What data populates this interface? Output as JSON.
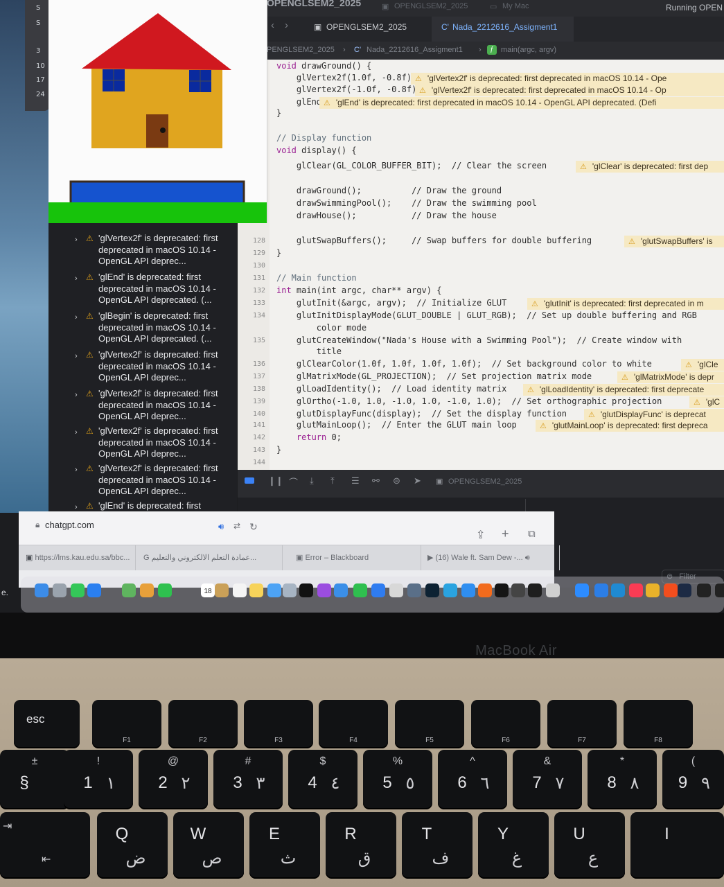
{
  "xcode": {
    "window_title": "OPENGLSEM2_2025",
    "tabs": [
      {
        "label": "OPENGLSEM2_2025"
      },
      {
        "label": "Nada_2212616_Assigment1"
      }
    ],
    "run_status": "Running OPEN",
    "titlebar_project": "OPENGLSEM2_2025",
    "titlebar_device": "My Mac",
    "jumpbar": [
      "PENGLSEM2_2025",
      "Nada_2212616_Assigment1",
      "main(argc, argv)"
    ],
    "code_lines": [
      {
        "num": "",
        "text": "void drawGround() {",
        "warning": ""
      },
      {
        "num": "",
        "text": "    glVertex2f(1.0f, -0.8f);",
        "warning": "'glVertex2f' is deprecated: first deprecated in macOS 10.14 - Ope"
      },
      {
        "num": "",
        "text": "    glVertex2f(-1.0f, -0.8f);",
        "warning": "'glVertex2f' is deprecated: first deprecated in macOS 10.14 - Op"
      },
      {
        "num": "",
        "text": "    glEnd();",
        "warning": "'glEnd' is deprecated: first deprecated in macOS 10.14 - OpenGL API deprecated. (Defi"
      },
      {
        "num": "",
        "text": "}",
        "warning": ""
      },
      {
        "num": "",
        "text": "",
        "warning": ""
      },
      {
        "num": "",
        "text": "// Display function",
        "warning": ""
      },
      {
        "num": "",
        "text": "void display() {",
        "warning": ""
      },
      {
        "num": "",
        "text": "    glClear(GL_COLOR_BUFFER_BIT);  // Clear the screen",
        "warning": "'glClear' is deprecated: first dep"
      },
      {
        "num": "",
        "text": "",
        "warning": ""
      },
      {
        "num": "",
        "text": "    drawGround();          // Draw the ground",
        "warning": ""
      },
      {
        "num": "",
        "text": "    drawSwimmingPool();    // Draw the swimming pool",
        "warning": ""
      },
      {
        "num": "",
        "text": "    drawHouse();           // Draw the house",
        "warning": ""
      },
      {
        "num": "",
        "text": "",
        "warning": ""
      },
      {
        "num": "128",
        "text": "    glutSwapBuffers();     // Swap buffers for double buffering",
        "warning": "'glutSwapBuffers' is"
      },
      {
        "num": "129",
        "text": "}",
        "warning": ""
      },
      {
        "num": "130",
        "text": "",
        "warning": ""
      },
      {
        "num": "131",
        "text": "// Main function",
        "warning": ""
      },
      {
        "num": "132",
        "text": "int main(int argc, char** argv) {",
        "warning": ""
      },
      {
        "num": "133",
        "text": "    glutInit(&argc, argv);  // Initialize GLUT",
        "warning": "'glutInit' is deprecated: first deprecated in m"
      },
      {
        "num": "134",
        "text": "    glutInitDisplayMode(GLUT_DOUBLE | GLUT_RGB);  // Set up double buffering and RGB",
        "warning": ""
      },
      {
        "num": "",
        "text": "        color mode",
        "warning": ""
      },
      {
        "num": "135",
        "text": "    glutCreateWindow(\"Nada's House with a Swimming Pool\");  // Create window with",
        "warning": ""
      },
      {
        "num": "",
        "text": "        title",
        "warning": ""
      },
      {
        "num": "136",
        "text": "    glClearColor(1.0f, 1.0f, 1.0f, 1.0f);  // Set background color to white",
        "warning": "'glCle"
      },
      {
        "num": "137",
        "text": "    glMatrixMode(GL_PROJECTION);  // Set projection matrix mode",
        "warning": "'glMatrixMode' is depr"
      },
      {
        "num": "138",
        "text": "    glLoadIdentity();  // Load identity matrix",
        "warning": "'glLoadIdentity' is deprecated: first deprecate"
      },
      {
        "num": "139",
        "text": "    glOrtho(-1.0, 1.0, -1.0, 1.0, -1.0, 1.0);  // Set orthographic projection",
        "warning": "'glC"
      },
      {
        "num": "140",
        "text": "    glutDisplayFunc(display);  // Set the display function",
        "warning": "'glutDisplayFunc' is deprecat"
      },
      {
        "num": "141",
        "text": "    glutMainLoop();  // Enter the GLUT main loop",
        "warning": "'glutMainLoop' is deprecated: first depreca"
      },
      {
        "num": "142",
        "text": "    return 0;",
        "warning": ""
      },
      {
        "num": "143",
        "text": "}",
        "warning": ""
      },
      {
        "num": "144",
        "text": "",
        "warning": ""
      }
    ],
    "issues": [
      {
        "text": "'glVertex2f' is deprecated: first deprecated in macOS 10.14 - OpenGL API deprec..."
      },
      {
        "text": "'glEnd' is deprecated: first deprecated in macOS 10.14 - OpenGL API deprecated. (..."
      },
      {
        "text": "'glBegin' is deprecated: first deprecated in macOS 10.14 - OpenGL API deprecated. (..."
      },
      {
        "text": "'glVertex2f' is deprecated: first deprecated in macOS 10.14 - OpenGL API deprec..."
      },
      {
        "text": "'glVertex2f' is deprecated: first deprecated in macOS 10.14 - OpenGL API deprec..."
      },
      {
        "text": "'glVertex2f' is deprecated: first deprecated in macOS 10.14 - OpenGL API deprec..."
      },
      {
        "text": "'glVertex2f' is deprecated: first deprecated in macOS 10.14 - OpenGL API deprec..."
      },
      {
        "text": "'glEnd' is deprecated: first"
      }
    ],
    "debug_target": "OPENGLSEM2_2025",
    "filter_placeholder": "Filter"
  },
  "mini_panel": {
    "numbers": [
      "S",
      "S",
      "3",
      "10",
      "17",
      "24"
    ]
  },
  "gl_window": {
    "colors": {
      "roof": "#d0181f",
      "wall": "#e0a51f",
      "window": "#0a2a9e",
      "door": "#7a3a12",
      "pool": "#1553cf",
      "pool_border": "#3b2b1e",
      "ground": "#17c30b"
    }
  },
  "browser": {
    "url": "chatgpt.com",
    "tabs": [
      {
        "label": "https://lms.kau.edu.sa/bbc..."
      },
      {
        "label": "عمادة التعلم الالكتروني والتعليم..."
      },
      {
        "label": "Error – Blackboard"
      },
      {
        "label": "(16) Wale ft. Sam Dew -..."
      }
    ]
  },
  "dock": {
    "calendar_day": "18",
    "left_label": "e."
  },
  "laptop": {
    "brand": "MacBook Air",
    "fn_keys": [
      {
        "label": "esc",
        "fn": ""
      },
      {
        "label": "",
        "fn": "F1"
      },
      {
        "label": "",
        "fn": "F2"
      },
      {
        "label": "",
        "fn": "F3"
      },
      {
        "label": "",
        "fn": "F4"
      },
      {
        "label": "",
        "fn": "F5"
      },
      {
        "label": "",
        "fn": "F6"
      },
      {
        "label": "",
        "fn": "F7"
      },
      {
        "label": "",
        "fn": "F8"
      }
    ],
    "number_keys": [
      {
        "top": "±",
        "main": "§",
        "alt": ""
      },
      {
        "top": "!",
        "main": "1",
        "alt": "١"
      },
      {
        "top": "@",
        "main": "2",
        "alt": "٢"
      },
      {
        "top": "#",
        "main": "3",
        "alt": "٣"
      },
      {
        "top": "$",
        "main": "4",
        "alt": "٤"
      },
      {
        "top": "%",
        "main": "5",
        "alt": "٥"
      },
      {
        "top": "^",
        "main": "6",
        "alt": "٦"
      },
      {
        "top": "&",
        "main": "7",
        "alt": "٧"
      },
      {
        "top": "*",
        "main": "8",
        "alt": "٨"
      },
      {
        "top": "(",
        "main": "9",
        "alt": "٩"
      }
    ],
    "letter_keys": [
      {
        "main": "Q",
        "alt": "ض"
      },
      {
        "main": "W",
        "alt": "ص"
      },
      {
        "main": "E",
        "alt": "ث"
      },
      {
        "main": "R",
        "alt": "ق"
      },
      {
        "main": "T",
        "alt": "ف"
      },
      {
        "main": "Y",
        "alt": "غ"
      },
      {
        "main": "U",
        "alt": "ع"
      },
      {
        "main": "I",
        "alt": ""
      }
    ]
  }
}
